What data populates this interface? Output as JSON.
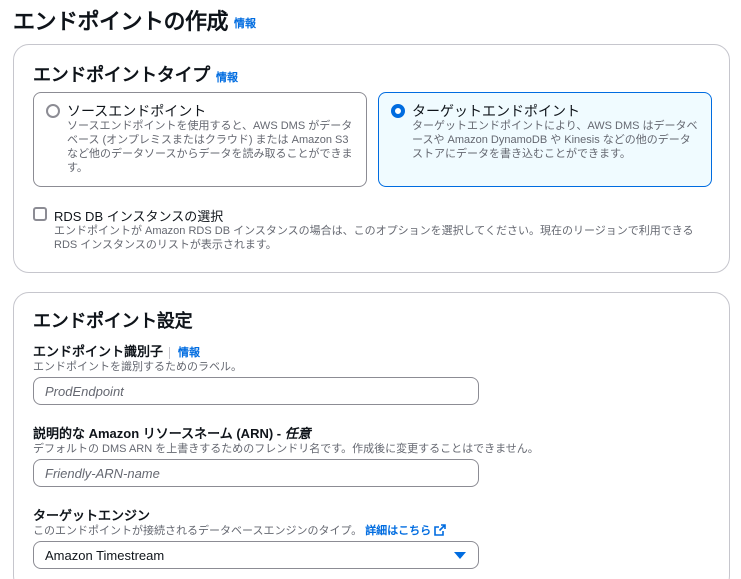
{
  "page": {
    "title": "エンドポイントの作成",
    "info": "情報"
  },
  "endpoint_type": {
    "heading": "エンドポイントタイプ",
    "info": "情報",
    "options": [
      {
        "title": "ソースエンドポイント",
        "description": "ソースエンドポイントを使用すると、AWS DMS がデータベース (オンプレミスまたはクラウド) または Amazon S3 など他のデータソースからデータを読み取ることができます。",
        "selected": false
      },
      {
        "title": "ターゲットエンドポイント",
        "description": "ターゲットエンドポイントにより、AWS DMS はデータベースや Amazon DynamoDB や Kinesis などの他のデータストアにデータを書き込むことができます。",
        "selected": true
      }
    ],
    "rds_checkbox": {
      "label": "RDS DB インスタンスの選択",
      "description": "エンドポイントが Amazon RDS DB インスタンスの場合は、このオプションを選択してください。現在のリージョンで利用できる RDS インスタンスのリストが表示されます。",
      "checked": false
    }
  },
  "endpoint_settings": {
    "heading": "エンドポイント設定",
    "identifier": {
      "label": "エンドポイント識別子",
      "info": "情報",
      "description": "エンドポイントを識別するためのラベル。",
      "placeholder": "ProdEndpoint",
      "value": ""
    },
    "arn": {
      "label": "説明的な Amazon リソースネーム (ARN) - ",
      "optional": "任意",
      "description": "デフォルトの DMS ARN を上書きするためのフレンドリ名です。作成後に変更することはできません。",
      "placeholder": "Friendly-ARN-name",
      "value": ""
    },
    "engine": {
      "label": "ターゲットエンジン",
      "description": "このエンドポイントが接続されるデータベースエンジンのタイプ。",
      "learn_more": "詳細はこちら",
      "selected": "Amazon Timestream"
    }
  },
  "colors": {
    "accent": "#006ce0",
    "selected_bg": "#f0fbff",
    "border": "#8c8c94",
    "muted_text": "#656871"
  }
}
